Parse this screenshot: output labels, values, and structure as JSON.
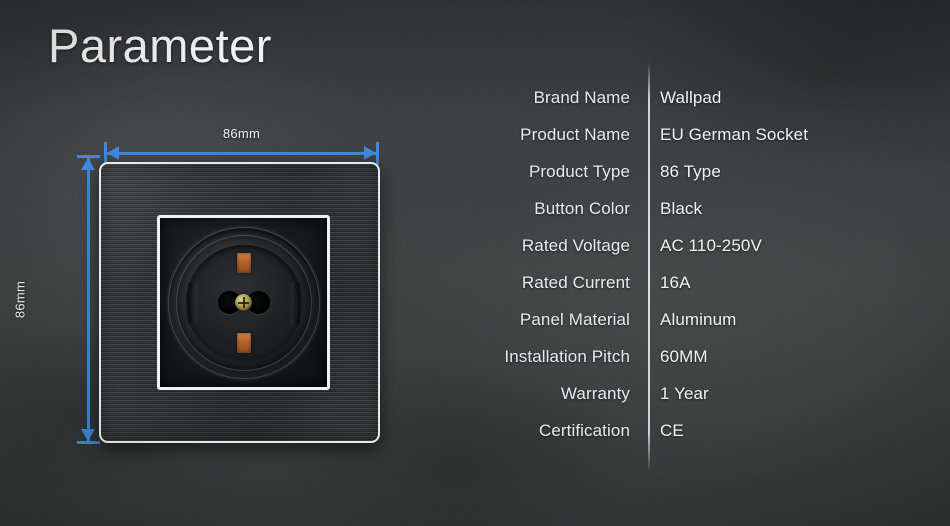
{
  "page": {
    "title": "Parameter",
    "background_color": "#3b3d3f"
  },
  "diagram": {
    "accent_color": "#3f8bdd",
    "width_label": "86mm",
    "height_label": "86mm",
    "panel_border_color": "#e8e9ea",
    "earth_clip_color": "#b3642f",
    "product_description": "EU German Schuko wall socket, black brushed aluminum faceplate"
  },
  "spec": {
    "rows": [
      {
        "label": "Brand Name",
        "value": "Wallpad"
      },
      {
        "label": "Product Name",
        "value": "EU German Socket"
      },
      {
        "label": "Product Type",
        "value": "86 Type"
      },
      {
        "label": "Button Color",
        "value": "Black"
      },
      {
        "label": "Rated Voltage",
        "value": "AC 110-250V"
      },
      {
        "label": "Rated Current",
        "value": "16A"
      },
      {
        "label": "Panel Material",
        "value": "Aluminum"
      },
      {
        "label": "Installation Pitch",
        "value": "60MM"
      },
      {
        "label": "Warranty",
        "value": "1 Year"
      },
      {
        "label": "Certification",
        "value": "CE"
      }
    ]
  }
}
